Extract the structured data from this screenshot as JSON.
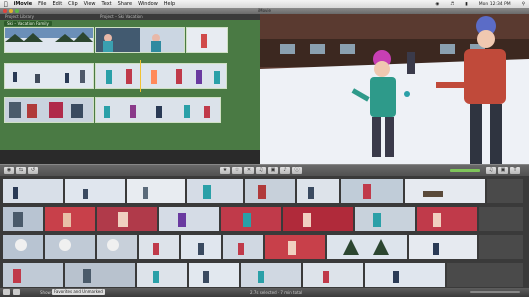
{
  "menubar": {
    "app_name": "iMovie",
    "items": [
      "File",
      "Edit",
      "Clip",
      "View",
      "Text",
      "Share",
      "Window",
      "Help"
    ],
    "clock": "Mon 12:34 PM"
  },
  "window": {
    "title": "iMovie"
  },
  "project_header": {
    "label": "Project Library",
    "project_title": "Project – Ski Vacation"
  },
  "project_label": "Ski – Vacation Family",
  "toolbar": {},
  "bottom": {
    "show_label": "Show:",
    "show_value": "Favorites and Unmarked",
    "selection_info": "2.7s selected · 7 min total"
  },
  "colors": {
    "project_bg": "#4a7a44",
    "selection": "#f1c232",
    "dark_bg": "#2a2a2a"
  }
}
